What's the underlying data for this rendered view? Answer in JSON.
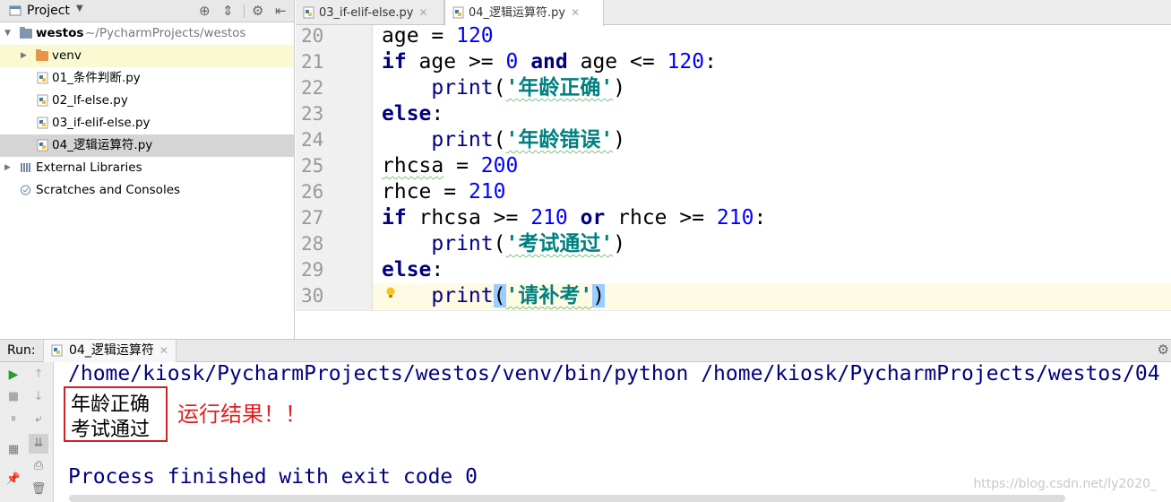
{
  "project": {
    "title": "Project",
    "root": {
      "name": "westos",
      "path": "~/PycharmProjects/westos"
    },
    "items": [
      {
        "label": "venv"
      },
      {
        "label": "01_条件判断.py"
      },
      {
        "label": "02_lf-else.py"
      },
      {
        "label": "03_if-elif-else.py"
      },
      {
        "label": "04_逻辑运算符.py"
      }
    ],
    "external_libraries": "External Libraries",
    "scratches": "Scratches and Consoles"
  },
  "tabs": [
    {
      "label": "03_if-elif-else.py",
      "active": false
    },
    {
      "label": "04_逻辑运算符.py",
      "active": true
    }
  ],
  "editor": {
    "line_numbers": [
      "20",
      "21",
      "22",
      "23",
      "24",
      "25",
      "26",
      "27",
      "28",
      "29",
      "30"
    ],
    "code": {
      "l20_var": "age",
      "l20_op": " = ",
      "l20_val": "120",
      "l21_kw": "if",
      "l21_a": " age >= ",
      "l21_n1": "0",
      "l21_and": "and",
      "l21_b": " age <= ",
      "l21_n2": "120",
      "l21_colon": ":",
      "l22_fn": "print",
      "l22_open": "(",
      "l22_str": "'年龄正确'",
      "l22_close": ")",
      "l23_kw": "else",
      "l23_colon": ":",
      "l24_fn": "print",
      "l24_open": "(",
      "l24_str": "'年龄错误'",
      "l24_close": ")",
      "l25_var": "rhcsa",
      "l25_op": " = ",
      "l25_val": "200",
      "l26_var": "rhce",
      "l26_op": " = ",
      "l26_val": "210",
      "l27_kw": "if",
      "l27_a": " rhcsa >= ",
      "l27_n1": "210",
      "l27_or": "or",
      "l27_b": " rhce >= ",
      "l27_n2": "210",
      "l27_colon": ":",
      "l28_fn": "print",
      "l28_open": "(",
      "l28_str": "'考试通过'",
      "l28_close": ")",
      "l29_kw": "else",
      "l29_colon": ":",
      "l30_fn": "print",
      "l30_open": "(",
      "l30_str": "'请补考'",
      "l30_close": ")"
    }
  },
  "run": {
    "label": "Run:",
    "tab": "04_逻辑运算符",
    "command": "/home/kiosk/PycharmProjects/westos/venv/bin/python /home/kiosk/PycharmProjects/westos/04",
    "output": [
      "年龄正确",
      "考试通过"
    ],
    "annotation": "运行结果！！",
    "exit": "Process finished with exit code 0"
  },
  "watermark": "https://blog.csdn.net/ly2020_",
  "colors": {
    "keyword": "#000080",
    "number": "#0000ff",
    "string": "#008080",
    "annotation": "#e02020"
  }
}
